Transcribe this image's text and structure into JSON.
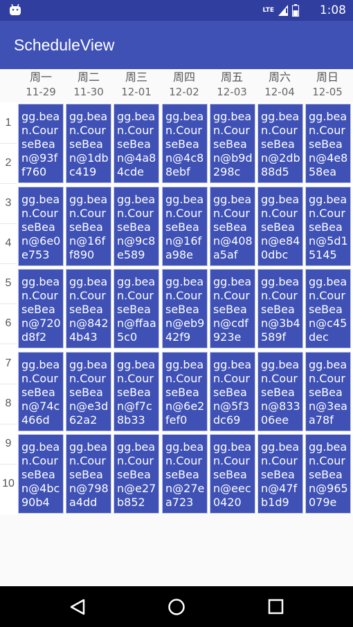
{
  "status_bar": {
    "time": "1:08",
    "network": "LTE",
    "icons": [
      "android-icon",
      "lte-icon",
      "signal-icon",
      "battery-icon"
    ]
  },
  "app_bar": {
    "title": "ScheduleView"
  },
  "days": [
    {
      "name": "周一",
      "date": "11-29"
    },
    {
      "name": "周二",
      "date": "11-30"
    },
    {
      "name": "周三",
      "date": "12-01"
    },
    {
      "name": "周四",
      "date": "12-02"
    },
    {
      "name": "周五",
      "date": "12-03"
    },
    {
      "name": "周六",
      "date": "12-04"
    },
    {
      "name": "周日",
      "date": "12-05"
    }
  ],
  "row_numbers": [
    "1",
    "2",
    "3",
    "4",
    "5",
    "6",
    "7",
    "8",
    "9",
    "10"
  ],
  "schedule": [
    [
      "gg.bean.CourseBean@93ff760",
      "gg.bean.CourseBean@1dbc419",
      "gg.bean.CourseBean@4a84cde",
      "gg.bean.CourseBean@4c88ebf",
      "gg.bean.CourseBean@b9d298c",
      "gg.bean.CourseBean@2db88d5",
      "gg.bean.CourseBean@4e858ea"
    ],
    [
      "gg.bean.CourseBean@6e0e753",
      "gg.bean.CourseBean@16ff890",
      "gg.bean.CourseBean@9c8e589",
      "gg.bean.CourseBean@16fa98e",
      "gg.bean.CourseBean@408a5af",
      "gg.bean.CourseBean@e840dbc",
      "gg.bean.CourseBean@5d15145"
    ],
    [
      "gg.bean.CourseBean@720d8f2",
      "gg.bean.CourseBean@8424b43",
      "gg.bean.CourseBean@ffaa5c0",
      "gg.bean.CourseBean@eb942f9",
      "gg.bean.CourseBean@cdf923e",
      "gg.bean.CourseBean@3b4589f",
      "gg.bean.CourseBean@c45dec"
    ],
    [
      "gg.bean.CourseBean@74c466d",
      "gg.bean.CourseBean@e3d62a2",
      "gg.bean.CourseBean@f7c8b33",
      "gg.bean.CourseBean@6e2fef0",
      "gg.bean.CourseBean@5f3dc69",
      "gg.bean.CourseBean@83306ee",
      "gg.bean.CourseBean@3eaa78f"
    ],
    [
      "gg.bean.CourseBean@4bc90b4",
      "gg.bean.CourseBean@798a4dd",
      "gg.bean.CourseBean@e27b852",
      "gg.bean.CourseBean@27ea723",
      "gg.bean.CourseBean@eec0420",
      "gg.bean.CourseBean@47fb1d9",
      "gg.bean.CourseBean@965079e"
    ]
  ],
  "nav_bar": {
    "buttons": [
      "back-icon",
      "home-icon",
      "recents-icon"
    ]
  },
  "colors": {
    "status_bar": "#303f9f",
    "app_bar": "#3f51b5",
    "cell": "#3f51b5",
    "cell_border": "#c5cae9",
    "nav_bar": "#000000"
  }
}
